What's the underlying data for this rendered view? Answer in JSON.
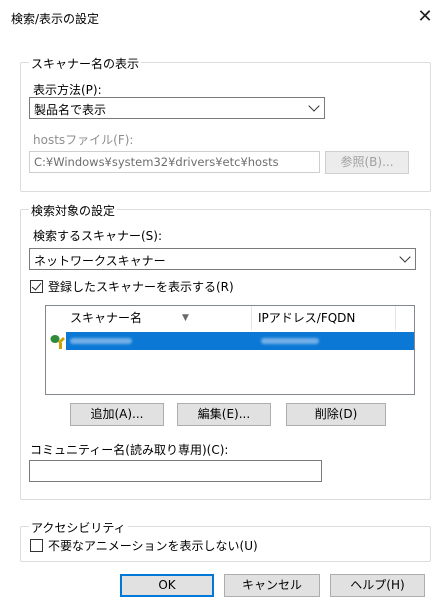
{
  "window": {
    "title": "検索/表示の設定",
    "close_glyph": "✕"
  },
  "scanner_name_group": {
    "legend": "スキャナー名の表示",
    "display_method_label": "表示方法(P):",
    "display_method_value": "製品名で表示",
    "hosts_label": "hostsファイル(F):",
    "hosts_value": "C:¥Windows¥system32¥drivers¥etc¥hosts",
    "browse_button": "参照(B)..."
  },
  "search_target_group": {
    "legend": "検索対象の設定",
    "scanner_label": "検索するスキャナー(S):",
    "scanner_value": "ネットワークスキャナー",
    "show_registered_label": "登録したスキャナーを表示する(R)",
    "show_registered_checked": true,
    "list": {
      "columns": [
        "スキャナー名",
        "IPアドレス/FQDN"
      ],
      "sort_glyph": "▼"
    },
    "add_button": "追加(A)...",
    "edit_button": "編集(E)...",
    "delete_button": "削除(D)",
    "community_label": "コミュニティー名(読み取り専用)(C):",
    "community_value": ""
  },
  "accessibility_group": {
    "legend": "アクセシビリティ",
    "no_animation_label": "不要なアニメーションを表示しない(U)",
    "no_animation_checked": false
  },
  "footer": {
    "ok_button": "OK",
    "cancel_button": "キャンセル",
    "help_button": "ヘルプ(H)"
  },
  "colors": {
    "selection": "#0a78d4",
    "default_button_border": "#0078d7",
    "disabled_text": "#8e8e8e"
  }
}
